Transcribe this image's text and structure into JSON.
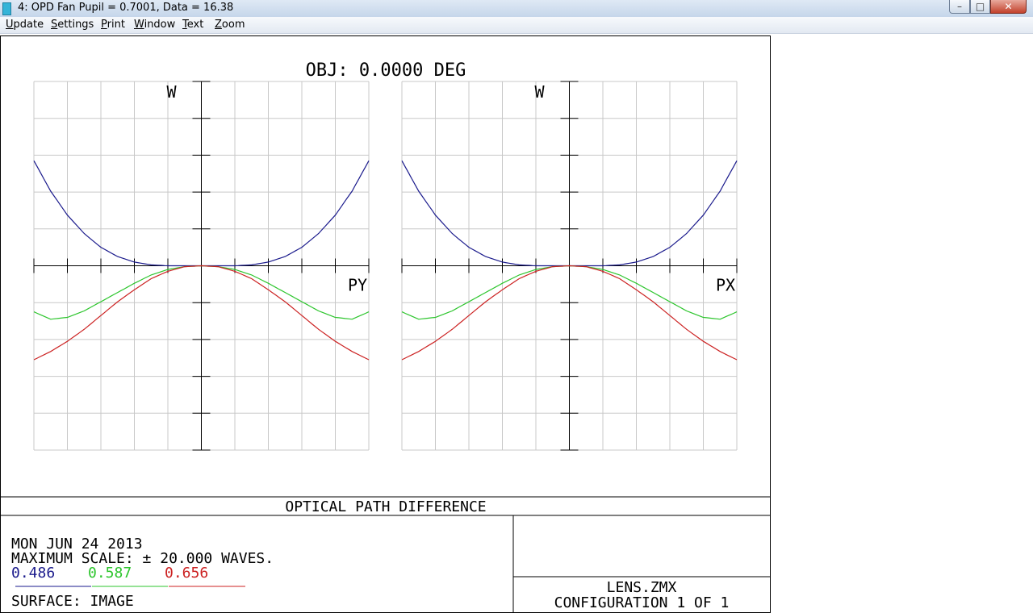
{
  "window": {
    "title": "4: OPD Fan Pupil = 0.7001, Data = 16.38",
    "min_glyph": "–",
    "max_glyph": "□",
    "close_glyph": "✕"
  },
  "menu": [
    "Update",
    "Settings",
    "Print",
    "Window",
    "Text",
    "Zoom"
  ],
  "plot": {
    "title": "OBJ: 0.0000 DEG",
    "footer_title": "OPTICAL PATH DIFFERENCE",
    "date": "MON JUN 24 2013",
    "max_scale": "MAXIMUM SCALE: ± 20.000 WAVES.",
    "surface": "SURFACE: IMAGE",
    "lens_file": "LENS.ZMX",
    "configuration": "CONFIGURATION 1 OF 1",
    "colors": {
      "blue": "#1a1a8c",
      "green": "#2cc52c",
      "red": "#cc2222",
      "grid": "#c8c8c8"
    }
  },
  "chart_data": [
    {
      "type": "line",
      "title": "OBJ: 0.0000 DEG",
      "ylabel": "W",
      "xlabel": "PY",
      "xlim": [
        -1,
        1
      ],
      "ylim": [
        -20,
        20
      ],
      "grid": true,
      "series": [
        {
          "name": "0.486",
          "color": "#1a1a8c",
          "x": [
            -1,
            -0.9,
            -0.8,
            -0.7,
            -0.6,
            -0.5,
            -0.4,
            -0.3,
            -0.2,
            -0.1,
            0,
            0.1,
            0.2,
            0.3,
            0.4,
            0.5,
            0.6,
            0.7,
            0.8,
            0.9,
            1
          ],
          "y": [
            11.4,
            8.1,
            5.5,
            3.5,
            2.0,
            1.0,
            0.4,
            0.1,
            0.0,
            0.0,
            0,
            0.0,
            0.0,
            0.1,
            0.4,
            1.0,
            2.0,
            3.5,
            5.5,
            8.1,
            11.4
          ]
        },
        {
          "name": "0.587",
          "color": "#2cc52c",
          "x": [
            -1,
            -0.9,
            -0.8,
            -0.7,
            -0.6,
            -0.5,
            -0.4,
            -0.3,
            -0.2,
            -0.1,
            0,
            0.1,
            0.2,
            0.3,
            0.4,
            0.5,
            0.6,
            0.7,
            0.8,
            0.9,
            1
          ],
          "y": [
            -5.0,
            -5.8,
            -5.6,
            -4.9,
            -3.9,
            -2.9,
            -1.9,
            -1.0,
            -0.4,
            -0.1,
            0,
            -0.1,
            -0.4,
            -1.0,
            -1.9,
            -2.9,
            -3.9,
            -4.9,
            -5.6,
            -5.8,
            -5.0
          ]
        },
        {
          "name": "0.656",
          "color": "#cc2222",
          "x": [
            -1,
            -0.9,
            -0.8,
            -0.7,
            -0.6,
            -0.5,
            -0.4,
            -0.3,
            -0.2,
            -0.1,
            0,
            0.1,
            0.2,
            0.3,
            0.4,
            0.5,
            0.6,
            0.7,
            0.8,
            0.9,
            1
          ],
          "y": [
            -10.2,
            -9.3,
            -8.2,
            -6.9,
            -5.4,
            -3.9,
            -2.6,
            -1.4,
            -0.6,
            -0.1,
            0,
            -0.1,
            -0.6,
            -1.4,
            -2.6,
            -3.9,
            -5.4,
            -6.9,
            -8.2,
            -9.3,
            -10.2
          ]
        }
      ]
    },
    {
      "type": "line",
      "ylabel": "W",
      "xlabel": "PX",
      "xlim": [
        -1,
        1
      ],
      "ylim": [
        -20,
        20
      ],
      "grid": true,
      "series": [
        {
          "name": "0.486",
          "color": "#1a1a8c",
          "x": [
            -1,
            -0.9,
            -0.8,
            -0.7,
            -0.6,
            -0.5,
            -0.4,
            -0.3,
            -0.2,
            -0.1,
            0,
            0.1,
            0.2,
            0.3,
            0.4,
            0.5,
            0.6,
            0.7,
            0.8,
            0.9,
            1
          ],
          "y": [
            11.4,
            8.1,
            5.5,
            3.5,
            2.0,
            1.0,
            0.4,
            0.1,
            0.0,
            0.0,
            0,
            0.0,
            0.0,
            0.1,
            0.4,
            1.0,
            2.0,
            3.5,
            5.5,
            8.1,
            11.4
          ]
        },
        {
          "name": "0.587",
          "color": "#2cc52c",
          "x": [
            -1,
            -0.9,
            -0.8,
            -0.7,
            -0.6,
            -0.5,
            -0.4,
            -0.3,
            -0.2,
            -0.1,
            0,
            0.1,
            0.2,
            0.3,
            0.4,
            0.5,
            0.6,
            0.7,
            0.8,
            0.9,
            1
          ],
          "y": [
            -5.0,
            -5.8,
            -5.6,
            -4.9,
            -3.9,
            -2.9,
            -1.9,
            -1.0,
            -0.4,
            -0.1,
            0,
            -0.1,
            -0.4,
            -1.0,
            -1.9,
            -2.9,
            -3.9,
            -4.9,
            -5.6,
            -5.8,
            -5.0
          ]
        },
        {
          "name": "0.656",
          "color": "#cc2222",
          "x": [
            -1,
            -0.9,
            -0.8,
            -0.7,
            -0.6,
            -0.5,
            -0.4,
            -0.3,
            -0.2,
            -0.1,
            0,
            0.1,
            0.2,
            0.3,
            0.4,
            0.5,
            0.6,
            0.7,
            0.8,
            0.9,
            1
          ],
          "y": [
            -10.2,
            -9.3,
            -8.2,
            -6.9,
            -5.4,
            -3.9,
            -2.6,
            -1.4,
            -0.6,
            -0.1,
            0,
            -0.1,
            -0.6,
            -1.4,
            -2.6,
            -3.9,
            -5.4,
            -6.9,
            -8.2,
            -9.3,
            -10.2
          ]
        }
      ]
    }
  ]
}
